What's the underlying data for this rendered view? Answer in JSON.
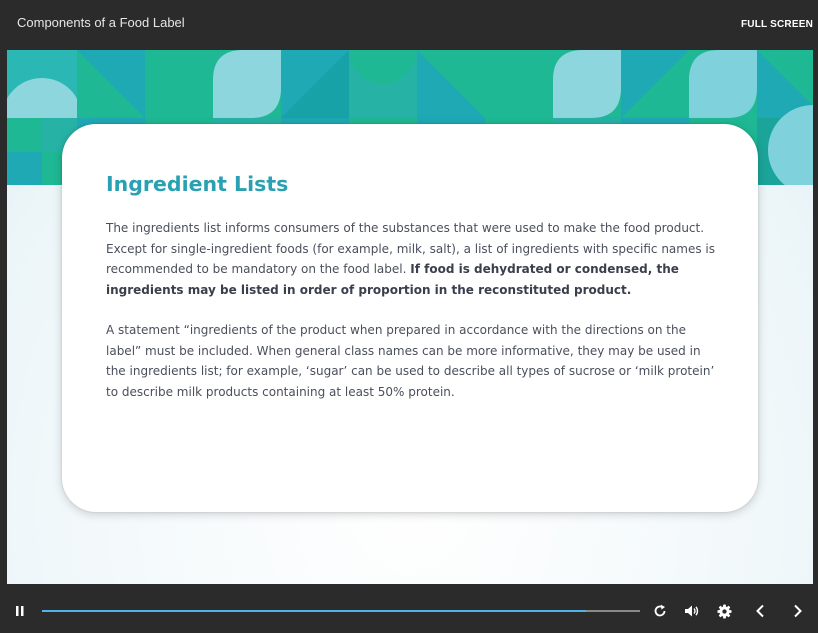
{
  "window": {
    "title": "Components of a Food Label",
    "fullscreen_label": "FULL SCREEN"
  },
  "slide": {
    "heading": "Ingredient Lists",
    "paragraph1_regular": "The ingredients list informs consumers of the substances that were used to make the food product. Except for single-ingredient foods (for example, milk, salt), a list of ingredients with specific names is recommended to be mandatory on the food label. ",
    "paragraph1_bold": "If food is dehydrated or condensed, the ingredients may be listed in order of proportion in the reconstituted product.",
    "paragraph2": "A statement “ingredients of the product when prepared in accordance with the directions on the label” must be included. When general class names can be more informative, they may be used in the ingredients list; for example, ‘sugar’ can be used to describe all types of sucrose or ‘milk protein’ to describe milk products containing at least 50% protein."
  },
  "playback": {
    "progress_fraction": 0.91,
    "icons": [
      "pause-icon",
      "replay-icon",
      "volume-icon",
      "gear-icon",
      "chevron-left-icon",
      "chevron-right-icon"
    ]
  },
  "colors": {
    "heading": "#2aa0b3",
    "progress_fill": "#4fb3e6",
    "banner_teal": "#1fa9b5",
    "banner_green": "#1fb894",
    "banner_light": "#7fd1dc"
  }
}
